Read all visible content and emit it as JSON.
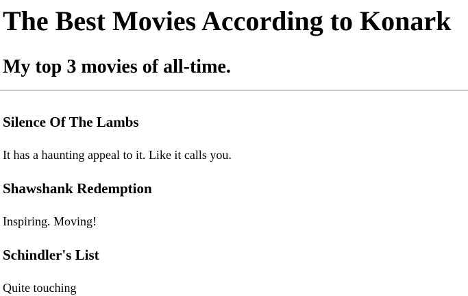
{
  "page": {
    "title": "The Best Movies According to Konark",
    "subtitle": "My top 3 movies of all-time."
  },
  "movies": [
    {
      "title": "Silence Of The Lambs",
      "description": "It has a haunting appeal to it. Like it calls you."
    },
    {
      "title": "Shawshank Redemption",
      "description": "Inspiring. Moving!"
    },
    {
      "title": "Schindler's List",
      "description": "Quite touching"
    }
  ]
}
